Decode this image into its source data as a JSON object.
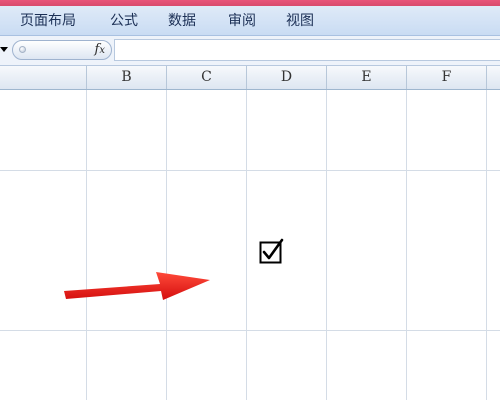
{
  "ribbon": {
    "tabs": [
      {
        "label": "页面布局"
      },
      {
        "label": "公式"
      },
      {
        "label": "数据"
      },
      {
        "label": "审阅"
      },
      {
        "label": "视图"
      }
    ]
  },
  "formula_bar": {
    "fx_label": "fx",
    "value": ""
  },
  "columns": [
    "B",
    "C",
    "D",
    "E",
    "F"
  ],
  "cells": {
    "checkbox_glyph": "checkbox-checked-icon",
    "checked": true
  },
  "annotation": {
    "arrow_color": "#ee1c1c"
  },
  "colors": {
    "accent_strip": "#e8547a",
    "ribbon_bg": "#d4e3f6",
    "grid_line": "#d4dce6"
  }
}
